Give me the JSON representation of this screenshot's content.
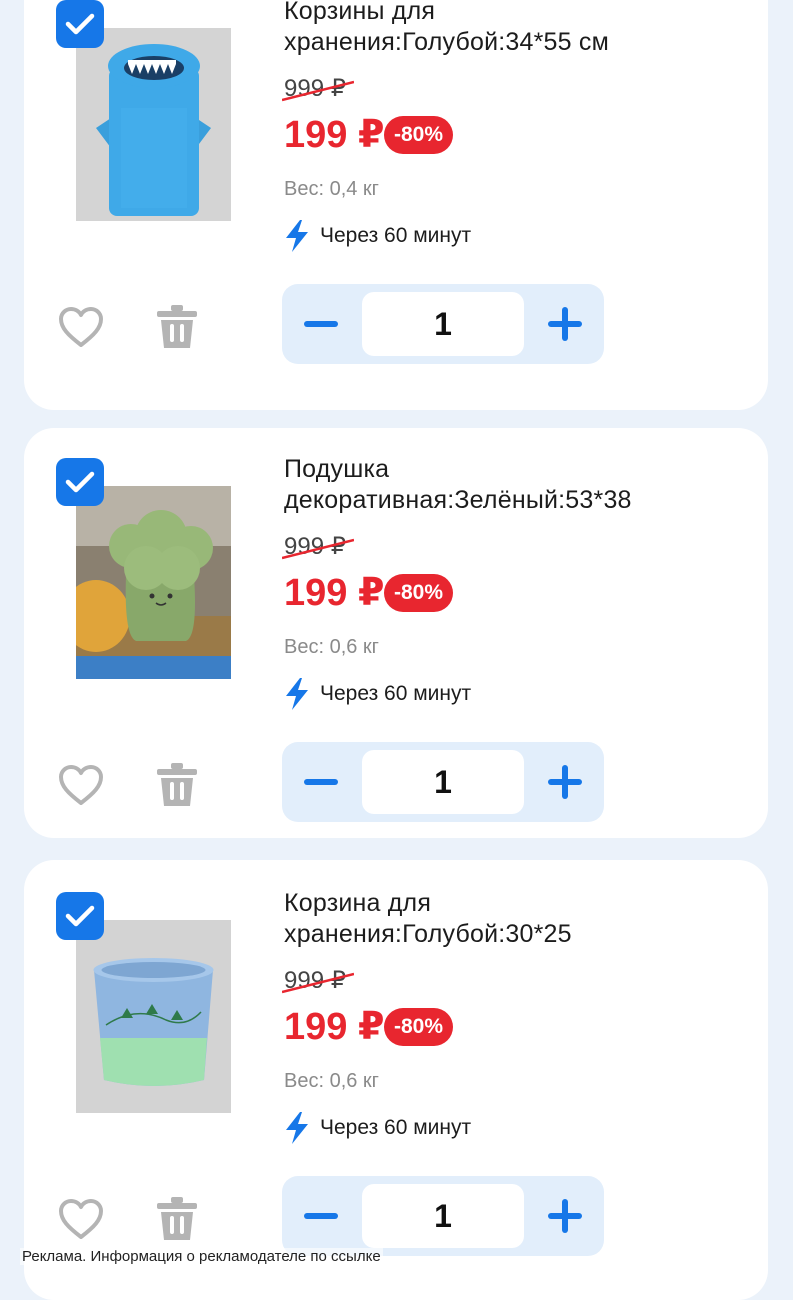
{
  "colors": {
    "background": "#ebf2fa",
    "accent": "#1677e8",
    "price": "#e8262f",
    "stepper_bg": "#e2eefb"
  },
  "items": [
    {
      "title": "Корзины для хранения:Голубой:34*55 см",
      "old_price": "999 ₽",
      "price": "199 ₽",
      "discount": "-80%",
      "weight": "Вес: 0,4 кг",
      "delivery": "Через 60 минут",
      "quantity": "1",
      "checked": true,
      "image_icon": "shark-storage-basket-image"
    },
    {
      "title": "Подушка декоративная:Зелёный:53*38",
      "old_price": "999 ₽",
      "price": "199 ₽",
      "discount": "-80%",
      "weight": "Вес: 0,6 кг",
      "delivery": "Через 60 минут",
      "quantity": "1",
      "checked": true,
      "image_icon": "broccoli-pillow-image"
    },
    {
      "title": "Корзина для хранения:Голубой:30*25",
      "old_price": "999 ₽",
      "price": "199 ₽",
      "discount": "-80%",
      "weight": "Вес: 0,6 кг",
      "delivery": "Через 60 минут",
      "quantity": "1",
      "checked": true,
      "image_icon": "rope-basket-image"
    }
  ],
  "ad_note": "Реклама. Информация о рекламодателе по ссылке"
}
